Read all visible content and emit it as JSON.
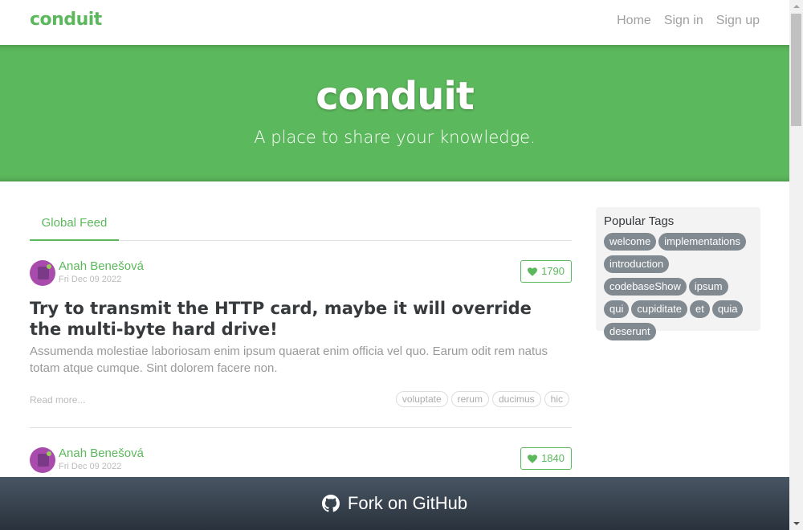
{
  "navbar": {
    "brand": "conduit",
    "links": [
      "Home",
      "Sign in",
      "Sign up"
    ]
  },
  "banner": {
    "title": "conduit",
    "subtitle": "A place to share your knowledge."
  },
  "feed": {
    "tab": "Global Feed",
    "articles": [
      {
        "author": "Anah Benešová",
        "date": "Fri Dec 09 2022",
        "likes": "1790",
        "title": "Try to transmit the HTTP card, maybe it will override the multi-byte hard drive!",
        "description": "Assumenda molestiae laboriosam enim ipsum quaerat enim officia vel quo. Earum odit rem natus totam atque cumque. Sint dolorem facere non.",
        "read_more": "Read more...",
        "tags": [
          "voluptate",
          "rerum",
          "ducimus",
          "hic"
        ]
      },
      {
        "author": "Anah Benešová",
        "date": "Fri Dec 09 2022",
        "likes": "1840"
      }
    ]
  },
  "sidebar": {
    "title": "Popular Tags",
    "tags": [
      "welcome",
      "implementations",
      "introduction",
      "codebaseShow",
      "ipsum",
      "qui",
      "cupiditate",
      "et",
      "quia",
      "deserunt"
    ]
  },
  "footer": {
    "fork_label": "Fork on GitHub",
    "icon": "github-icon"
  },
  "colors": {
    "brand": "#5cb85c",
    "tag": "#818a91",
    "fork_bar_top": "#485563",
    "fork_bar_bottom": "#29323c"
  }
}
